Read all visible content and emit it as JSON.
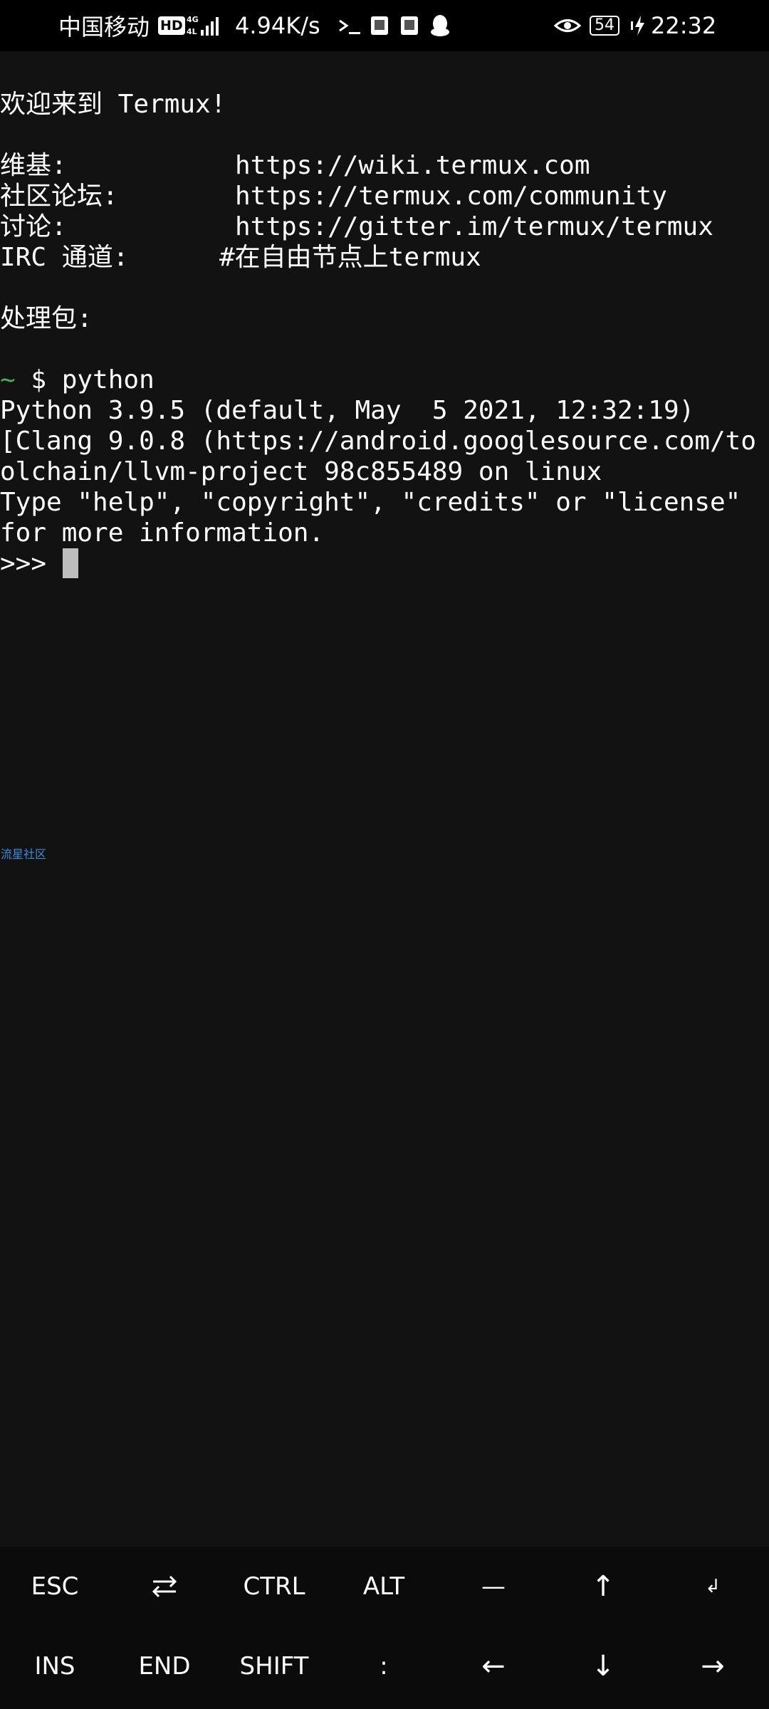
{
  "status_bar": {
    "carrier": "中国移动",
    "hd_badge": "HD",
    "network_type_top": "4G",
    "network_type_bottom": "⁴ᴳ",
    "speed": "4.94K/s",
    "battery_level": "54",
    "time": "22:32",
    "icons": [
      "hd-icon",
      "signal-icon",
      "terminal-icon",
      "app-notification-icon",
      "app-notification-icon",
      "qq-icon",
      "eye-icon",
      "battery-icon",
      "charging-icon"
    ]
  },
  "terminal": {
    "lines": [
      {
        "text": "欢迎来到 Termux!"
      },
      {
        "text": ""
      },
      {
        "label": "维基:",
        "value": "https://wiki.termux.com"
      },
      {
        "label": "社区论坛:",
        "value": "https://termux.com/community"
      },
      {
        "label": "讨论:",
        "value": "https://gitter.im/termux/termux"
      },
      {
        "label": "IRC 通道:",
        "value": "#在自由节点上termux"
      },
      {
        "text": ""
      },
      {
        "text": "处理包:"
      },
      {
        "text": ""
      },
      {
        "prompt_symbol": "~",
        "prompt_rest": " $ python"
      },
      {
        "text": "Python 3.9.5 (default, May  5 2021, 12:32:19)"
      },
      {
        "text": "[Clang 9.0.8 (https://android.googlesource.com/to"
      },
      {
        "text": "olchain/llvm-project 98c855489 on linux"
      },
      {
        "text": "Type \"help\", \"copyright\", \"credits\" or \"license\""
      },
      {
        "text": "for more information."
      },
      {
        "text": ">>> "
      }
    ],
    "welcome": "欢迎来到 Termux!",
    "wiki_label": "维基:",
    "wiki_url": "https://wiki.termux.com",
    "community_label": "社区论坛:",
    "community_url": "https://termux.com/community",
    "discuss_label": "讨论:",
    "discuss_url": "https://gitter.im/termux/termux",
    "irc_label": "IRC 通道:",
    "irc_value": "#在自由节点上termux",
    "packages_label": "处理包:",
    "prompt_tilde": "~",
    "prompt_command": " $ python",
    "python_version": "Python 3.9.5 (default, May  5 2021, 12:32:19)",
    "clang_line_1": "[Clang 9.0.8 (https://android.googlesource.com/to",
    "clang_line_2": "olchain/llvm-project 98c855489 on linux",
    "help_line_1": "Type \"help\", \"copyright\", \"credits\" or \"license\"",
    "help_line_2": "for more information.",
    "repl_prompt": ">>> ",
    "watermark": "流星社区"
  },
  "extra_keys": {
    "row1": [
      "ESC",
      "⇄",
      "CTRL",
      "ALT",
      "—",
      "↑",
      "↲"
    ],
    "row2": [
      "INS",
      "END",
      "SHIFT",
      ":",
      "←",
      "↓",
      "→"
    ],
    "colors": {
      "background": "#0b0b0b",
      "text": "#ffffff"
    }
  },
  "colors": {
    "terminal_background": "#121212",
    "status_bar_background": "#000000",
    "prompt_tilde": "#4caf50",
    "cursor": "#bdbdbd",
    "watermark": "#3c8de0"
  }
}
